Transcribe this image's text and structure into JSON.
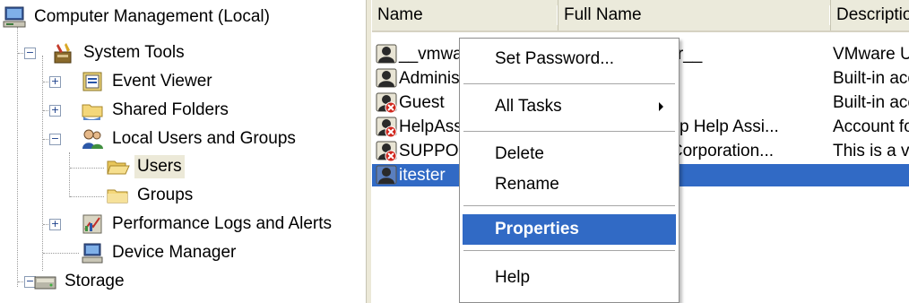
{
  "tree": {
    "root": "Computer Management (Local)",
    "system_tools": "System Tools",
    "event_viewer": "Event Viewer",
    "shared_folders": "Shared Folders",
    "local_users_groups": "Local Users and Groups",
    "users": "Users",
    "groups": "Groups",
    "perf_logs": "Performance Logs and Alerts",
    "device_manager": "Device Manager",
    "storage": "Storage"
  },
  "list": {
    "columns": [
      "Name",
      "Full Name",
      "Description"
    ],
    "rows": [
      {
        "name": "__vmware_user__",
        "full_name": "__vmware_user__",
        "description": "VMware User",
        "disabled": false,
        "selected": false
      },
      {
        "name": "Administrator",
        "full_name": "",
        "description": "Built-in account for administering",
        "disabled": false,
        "selected": false
      },
      {
        "name": "Guest",
        "full_name": "",
        "description": "Built-in account for guest access",
        "disabled": true,
        "selected": false
      },
      {
        "name": "HelpAssistant",
        "full_name": "Remote Desktop Help Assi...",
        "description": "Account for Providing Remote Assistance",
        "disabled": true,
        "selected": false
      },
      {
        "name": "SUPPORT_388945a0",
        "full_name": "CN=Microsoft Corporation...",
        "description": "This is a vendor's account",
        "disabled": true,
        "selected": false
      },
      {
        "name": "itester",
        "full_name": "",
        "description": "",
        "disabled": false,
        "selected": true
      }
    ]
  },
  "context_menu": {
    "set_password": "Set Password...",
    "all_tasks": "All Tasks",
    "delete": "Delete",
    "rename": "Rename",
    "properties": "Properties",
    "help": "Help"
  },
  "colors": {
    "selection": "#316ac5",
    "header_bg": "#ebeadb",
    "tree_selected_bg": "#ece9d8"
  }
}
